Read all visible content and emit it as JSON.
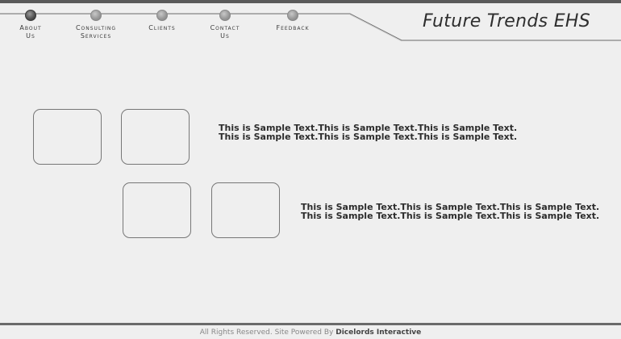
{
  "nav": {
    "items": [
      {
        "label": "About\nUs",
        "active": true
      },
      {
        "label": "Consulting\nServices",
        "active": false
      },
      {
        "label": "Clients",
        "active": false
      },
      {
        "label": "Contact\nUs",
        "active": false
      },
      {
        "label": "Feedback",
        "active": false
      }
    ]
  },
  "brand": "Future Trends EHS",
  "sections": [
    {
      "line1": "This is Sample Text.This is Sample Text.This is Sample Text.",
      "line2": "This is Sample Text.This is Sample Text.This is Sample Text."
    },
    {
      "line1": "This is Sample Text.This is Sample Text.This is Sample Text.",
      "line2": "This is Sample Text.This is Sample Text.This is Sample Text."
    }
  ],
  "footer": {
    "text": "All Rights Reserved. Site Powered By ",
    "company": "Dicelords Interactive"
  }
}
